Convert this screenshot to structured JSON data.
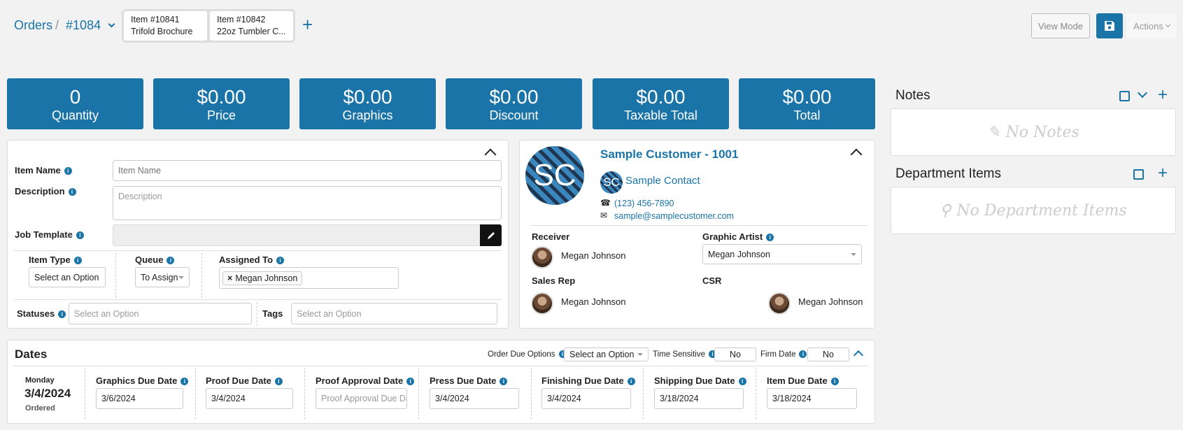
{
  "breadcrumb": {
    "root": "Orders",
    "separator": "/",
    "current": "#1084"
  },
  "item_tabs": [
    {
      "number": "Item #10841",
      "name": "Trifold Brochure"
    },
    {
      "number": "Item #10842",
      "name": "22oz Tumbler C..."
    }
  ],
  "toolbar": {
    "view_mode": "View Mode",
    "actions": "Actions"
  },
  "stats": [
    {
      "value": "0",
      "label": "Quantity"
    },
    {
      "value": "$0.00",
      "label": "Price"
    },
    {
      "value": "$0.00",
      "label": "Graphics"
    },
    {
      "value": "$0.00",
      "label": "Discount"
    },
    {
      "value": "$0.00",
      "label": "Taxable Total"
    },
    {
      "value": "$0.00",
      "label": "Total"
    }
  ],
  "item_form": {
    "item_name_label": "Item Name",
    "item_name_placeholder": "Item Name",
    "description_label": "Description",
    "description_placeholder": "Description",
    "job_template_label": "Job Template",
    "item_type_label": "Item Type",
    "item_type_value": "Select an Option",
    "queue_label": "Queue",
    "queue_value": "To Assign",
    "assigned_to_label": "Assigned To",
    "assigned_to_chip": "Megan Johnson",
    "statuses_label": "Statuses",
    "statuses_placeholder": "Select an Option",
    "tags_label": "Tags",
    "tags_placeholder": "Select an Option"
  },
  "customer": {
    "initials": "SC",
    "name": "Sample Customer - 1001",
    "contact_initials": "SC",
    "contact_name": "Sample Contact",
    "phone": "(123) 456-7890",
    "email": "sample@samplecustomer.com",
    "receiver_label": "Receiver",
    "receiver": "Megan Johnson",
    "graphic_artist_label": "Graphic Artist",
    "graphic_artist": "Megan Johnson",
    "sales_rep_label": "Sales Rep",
    "sales_rep": "Megan Johnson",
    "csr_label": "CSR",
    "csr": "Megan Johnson"
  },
  "notes": {
    "title": "Notes",
    "empty": "No Notes"
  },
  "department_items": {
    "title": "Department Items",
    "empty": "No Department Items"
  },
  "dates": {
    "title": "Dates",
    "order_due_options_label": "Order Due Options",
    "order_due_options_value": "Select an Option",
    "time_sensitive_label": "Time Sensitive",
    "time_sensitive_value": "No",
    "firm_date_label": "Firm Date",
    "firm_date_value": "No",
    "ordered_day": "Monday",
    "ordered_date": "3/4/2024",
    "ordered_label": "Ordered",
    "fields": [
      {
        "label": "Graphics Due Date",
        "value": "3/6/2024"
      },
      {
        "label": "Proof Due Date",
        "value": "3/4/2024"
      },
      {
        "label": "Proof Approval Date",
        "value": "",
        "placeholder": "Proof Approval Due Date"
      },
      {
        "label": "Press Due Date",
        "value": "3/4/2024"
      },
      {
        "label": "Finishing Due Date",
        "value": "3/4/2024"
      },
      {
        "label": "Shipping Due Date",
        "value": "3/18/2024"
      },
      {
        "label": "Item Due Date",
        "value": "3/18/2024"
      }
    ]
  },
  "colors": {
    "accent": "#1a74a8",
    "background": "#f2f2f2"
  }
}
